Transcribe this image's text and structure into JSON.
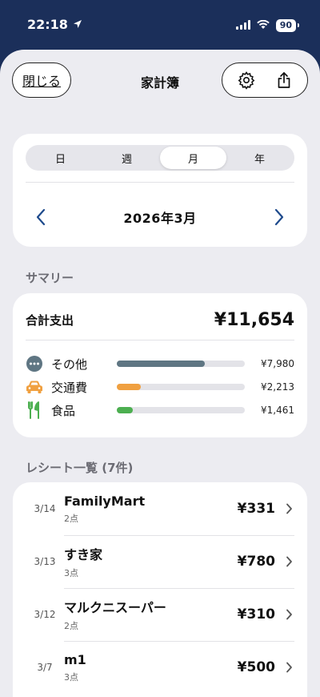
{
  "status": {
    "time": "22:18",
    "battery": "90"
  },
  "nav": {
    "close_label": "閉じる",
    "title": "家計簿"
  },
  "period": {
    "segments": [
      "日",
      "週",
      "月",
      "年"
    ],
    "active_segment": "月",
    "label": "2026年3月"
  },
  "summary": {
    "section_title": "サマリー",
    "total_label": "合計支出",
    "total_value": "¥11,654",
    "categories": [
      {
        "name": "その他",
        "amount": "¥7,980",
        "fraction": 0.685,
        "color": "#5f7683",
        "icon": "more-dots-icon"
      },
      {
        "name": "交通費",
        "amount": "¥2,213",
        "fraction": 0.19,
        "color": "#f0a040",
        "icon": "car-icon"
      },
      {
        "name": "食品",
        "amount": "¥1,461",
        "fraction": 0.125,
        "color": "#4caf50",
        "icon": "fork-knife-icon"
      }
    ]
  },
  "receipts": {
    "section_title": "レシート一覧 (7件)",
    "items": [
      {
        "date": "3/14",
        "name": "FamilyMart",
        "count": "2点",
        "amount": "¥331"
      },
      {
        "date": "3/13",
        "name": "すき家",
        "count": "3点",
        "amount": "¥780"
      },
      {
        "date": "3/12",
        "name": "マルクニスーパー",
        "count": "2点",
        "amount": "¥310"
      },
      {
        "date": "3/7",
        "name": "m1",
        "count": "3点",
        "amount": "¥500"
      }
    ]
  },
  "colors": {
    "header_bg": "#1b2f5a",
    "accent_blue": "#1e4a8c"
  }
}
